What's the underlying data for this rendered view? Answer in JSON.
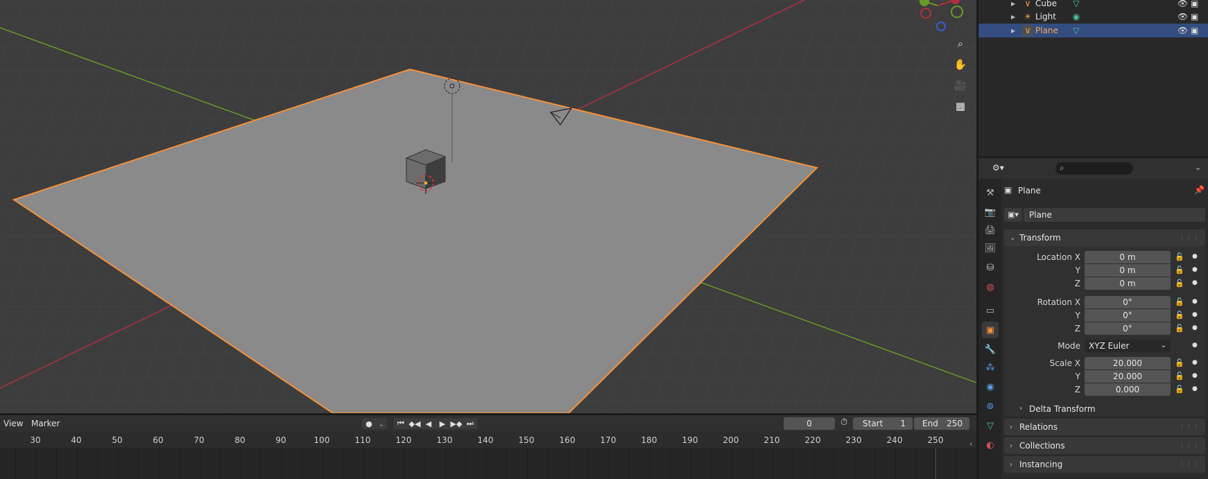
{
  "outliner": {
    "rows": [
      {
        "label": "Cube",
        "icon": "mesh-object-icon",
        "selected": false
      },
      {
        "label": "Light",
        "icon": "light-object-icon",
        "selected": false
      },
      {
        "label": "Plane",
        "icon": "mesh-object-icon",
        "selected": true
      }
    ]
  },
  "viewport": {
    "nav_icons": [
      "zoom-icon",
      "hand-pan-icon",
      "camera-view-icon",
      "perspective-grid-icon"
    ],
    "gizmo_axes": [
      "Y",
      "X",
      "Z"
    ],
    "colors": {
      "background": "#3d3d3d",
      "plane": "#8a8a8a",
      "outline": "#f5923a",
      "x_axis": "#b2303f",
      "y_axis": "#6a9a2a"
    }
  },
  "properties": {
    "object_name": "Plane",
    "datablock_name": "Plane",
    "search_placeholder": "",
    "transform": {
      "title": "Transform",
      "location": {
        "label_x": "Location X",
        "label_y": "Y",
        "label_z": "Z",
        "x": "0 m",
        "y": "0 m",
        "z": "0 m"
      },
      "rotation": {
        "label_x": "Rotation X",
        "label_y": "Y",
        "label_z": "Z",
        "x": "0°",
        "y": "0°",
        "z": "0°"
      },
      "mode_label": "Mode",
      "mode_value": "XYZ Euler",
      "scale": {
        "label_x": "Scale X",
        "label_y": "Y",
        "label_z": "Z",
        "x": "20.000",
        "y": "20.000",
        "z": "0.000"
      },
      "delta_transform": "Delta Transform"
    },
    "panels": [
      "Relations",
      "Collections",
      "Instancing"
    ]
  },
  "timeline": {
    "menu_view": "View",
    "menu_marker": "Marker",
    "current_frame": "0",
    "start_label": "Start",
    "start_value": "1",
    "end_label": "End",
    "end_value": "250",
    "ticks": [
      "30",
      "40",
      "50",
      "60",
      "70",
      "80",
      "90",
      "100",
      "110",
      "120",
      "130",
      "140",
      "150",
      "160",
      "170",
      "180",
      "190",
      "200",
      "210",
      "220",
      "230",
      "240",
      "250"
    ]
  }
}
